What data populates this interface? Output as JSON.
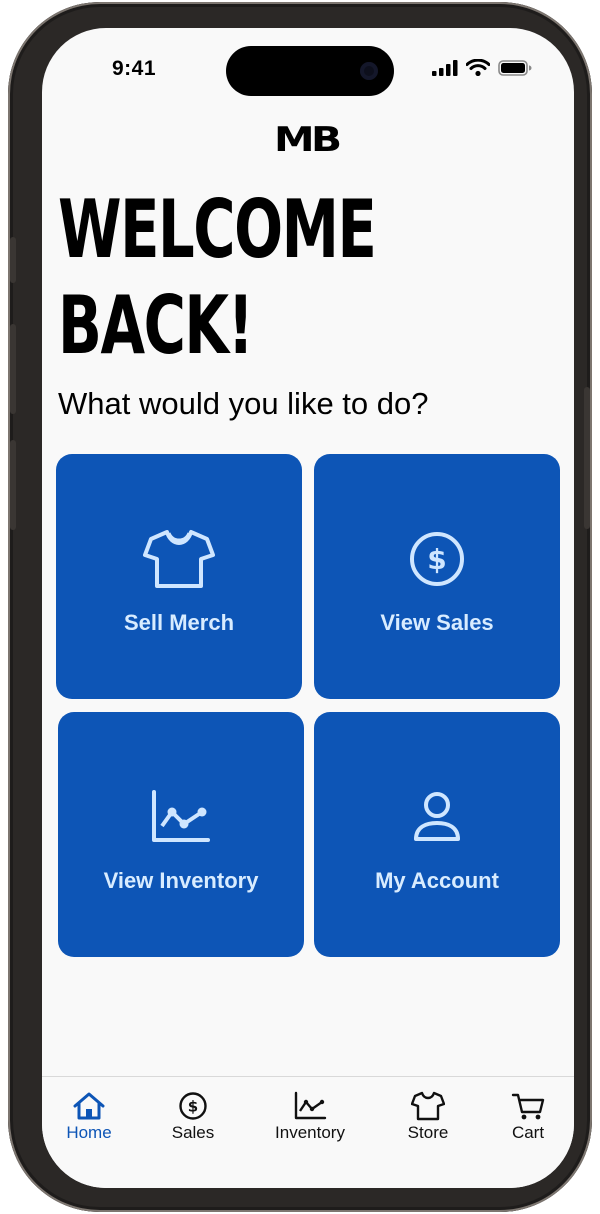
{
  "status_bar": {
    "time": "9:41"
  },
  "logo": "MB",
  "heading": {
    "line1": "WELCOME",
    "line2": "BACK!"
  },
  "subheading": "What would you like to do?",
  "actions": [
    {
      "label": "Sell Merch",
      "icon": "tshirt-icon"
    },
    {
      "label": "View Sales",
      "icon": "dollar-circle-icon"
    },
    {
      "label": "View Inventory",
      "icon": "line-chart-icon"
    },
    {
      "label": "My Account",
      "icon": "person-icon"
    }
  ],
  "tab_bar": {
    "items": [
      {
        "label": "Home",
        "icon": "house-icon",
        "active": true
      },
      {
        "label": "Sales",
        "icon": "dollar-circle-icon",
        "active": false
      },
      {
        "label": "Inventory",
        "icon": "line-chart-icon",
        "active": false
      },
      {
        "label": "Store",
        "icon": "tshirt-icon",
        "active": false
      },
      {
        "label": "Cart",
        "icon": "cart-icon",
        "active": false
      }
    ]
  },
  "colors": {
    "accent": "#0d55b6",
    "tile_text": "#d8ecff",
    "background": "#f9f9f9"
  }
}
